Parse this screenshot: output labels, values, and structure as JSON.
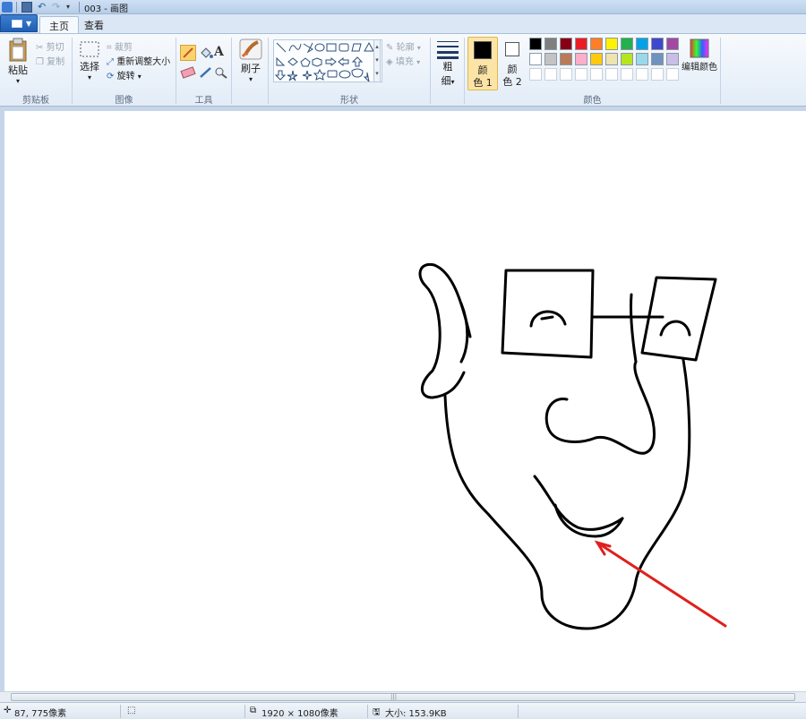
{
  "window": {
    "title": "003 - 画图"
  },
  "tabs": [
    {
      "label": "主页"
    },
    {
      "label": "查看"
    }
  ],
  "clipboard": {
    "paste": "粘贴",
    "cut": "剪切",
    "copy": "复制",
    "group": "剪贴板"
  },
  "image": {
    "select": "选择",
    "crop": "裁剪",
    "resize": "重新调整大小",
    "rotate": "旋转",
    "group": "图像"
  },
  "tools": {
    "group": "工具"
  },
  "brushes": {
    "label": "刷子"
  },
  "shapes": {
    "outline": "轮廓",
    "fill": "填充",
    "group": "形状"
  },
  "size": {
    "label_1": "粗",
    "label_2": "细"
  },
  "colors": {
    "color1_a": "颜",
    "color1_b": "色 1",
    "color2_a": "颜",
    "color2_b": "色 2",
    "edit": "编辑颜色",
    "group": "颜色",
    "palette_row1": [
      "#000000",
      "#7f7f7f",
      "#880015",
      "#ed1c24",
      "#ff7f27",
      "#fff200",
      "#22b14c",
      "#00a2e8",
      "#3f48cc",
      "#a349a4"
    ],
    "palette_row2": [
      "#ffffff",
      "#c3c3c3",
      "#b97a57",
      "#ffaec9",
      "#ffc90e",
      "#efe4b0",
      "#b5e61d",
      "#99d9ea",
      "#7092be",
      "#c8bfe7"
    ],
    "selected1": "#000000",
    "selected2": "#ffffff"
  },
  "drawing": {
    "stroke_color": "#000000",
    "arrow_color": "#e0201c"
  },
  "status": {
    "coords": "87, 775像素",
    "dimensions": "1920 × 1080像素",
    "filesize": "大小: 153.9KB"
  }
}
